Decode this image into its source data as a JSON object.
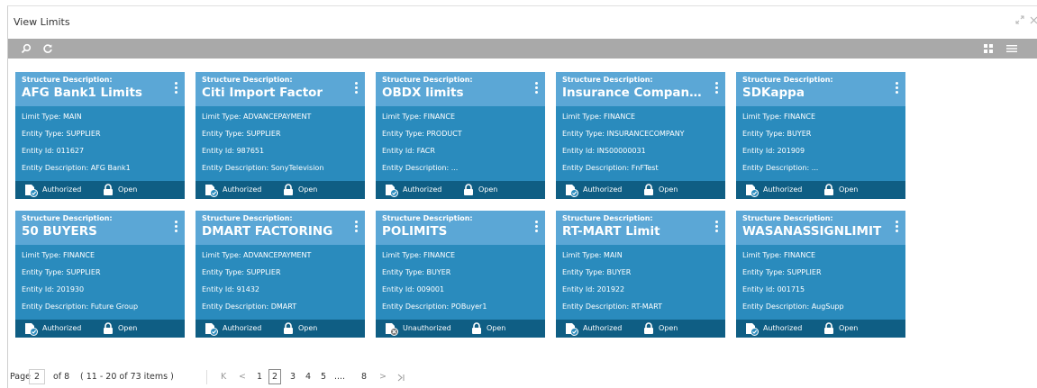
{
  "window": {
    "title": "View Limits",
    "icons": {
      "expand": "expand-icon",
      "close": "close-icon"
    }
  },
  "toolbar": {
    "icons": [
      "search-icon",
      "refresh-icon",
      "grid-view-icon",
      "list-view-icon"
    ]
  },
  "labels": {
    "structure_description": "Structure Description:"
  },
  "colors": {
    "card_body": "#2a8bbd",
    "card_header": "#5ba7d6",
    "card_footer": "#0f5e84",
    "toolbar": "#a9a9a9"
  },
  "cards": [
    {
      "structure": "AFG Bank1 Limits",
      "limit_type": "Limit Type: MAIN",
      "entity_type": "Entity Type: SUPPLIER",
      "entity_id": "Entity Id: 011627",
      "entity_desc": "Entity Description: AFG Bank1",
      "auth": "Authorized",
      "lock": "Open"
    },
    {
      "structure": "Citi Import Factor",
      "limit_type": "Limit Type: ADVANCEPAYMENT",
      "entity_type": "Entity Type: SUPPLIER",
      "entity_id": "Entity Id: 987651",
      "entity_desc": "Entity Description: SonyTelevision",
      "auth": "Authorized",
      "lock": "Open"
    },
    {
      "structure": "OBDX limits",
      "limit_type": "Limit Type: FINANCE",
      "entity_type": "Entity Type: PRODUCT",
      "entity_id": "Entity Id: FACR",
      "entity_desc": "Entity Description: ...",
      "auth": "Authorized",
      "lock": "Open"
    },
    {
      "structure": "Insurance Company ...",
      "limit_type": "Limit Type: FINANCE",
      "entity_type": "Entity Type: INSURANCECOMPANY",
      "entity_id": "Entity Id: INS00000031",
      "entity_desc": "Entity Description: FnFTest",
      "auth": "Authorized",
      "lock": "Open"
    },
    {
      "structure": "SDKappa",
      "limit_type": "Limit Type: FINANCE",
      "entity_type": "Entity Type: BUYER",
      "entity_id": "Entity Id: 201909",
      "entity_desc": "Entity Description: ...",
      "auth": "Authorized",
      "lock": "Open"
    },
    {
      "structure": "50 BUYERS",
      "limit_type": "Limit Type: FINANCE",
      "entity_type": "Entity Type: SUPPLIER",
      "entity_id": "Entity Id: 201930",
      "entity_desc": "Entity Description: Future Group",
      "auth": "Authorized",
      "lock": "Open"
    },
    {
      "structure": "DMART FACTORING",
      "limit_type": "Limit Type: ADVANCEPAYMENT",
      "entity_type": "Entity Type: SUPPLIER",
      "entity_id": "Entity Id: 91432",
      "entity_desc": "Entity Description: DMART",
      "auth": "Authorized",
      "lock": "Open"
    },
    {
      "structure": "POLIMITS",
      "limit_type": "Limit Type: FINANCE",
      "entity_type": "Entity Type: BUYER",
      "entity_id": "Entity Id: 009001",
      "entity_desc": "Entity Description: POBuyer1",
      "auth": "Unauthorized",
      "lock": "Open"
    },
    {
      "structure": "RT-MART Limit",
      "limit_type": "Limit Type: MAIN",
      "entity_type": "Entity Type: BUYER",
      "entity_id": "Entity Id: 201922",
      "entity_desc": "Entity Description: RT-MART",
      "auth": "Authorized",
      "lock": "Open"
    },
    {
      "structure": "WASANASSIGNLIMIT",
      "limit_type": "Limit Type: FINANCE",
      "entity_type": "Entity Type: SUPPLIER",
      "entity_id": "Entity Id: 001715",
      "entity_desc": "Entity Description: AugSupp",
      "auth": "Authorized",
      "lock": "Open"
    }
  ],
  "pagination": {
    "page_label": "Page",
    "current_page": "2",
    "of_label": "of 8",
    "items_info": "( 11 - 20 of 73 items )",
    "first": "K",
    "prev": "<",
    "next": ">",
    "last": "K",
    "pages": [
      "1",
      "2",
      "3",
      "4",
      "5",
      "....",
      "8"
    ]
  }
}
